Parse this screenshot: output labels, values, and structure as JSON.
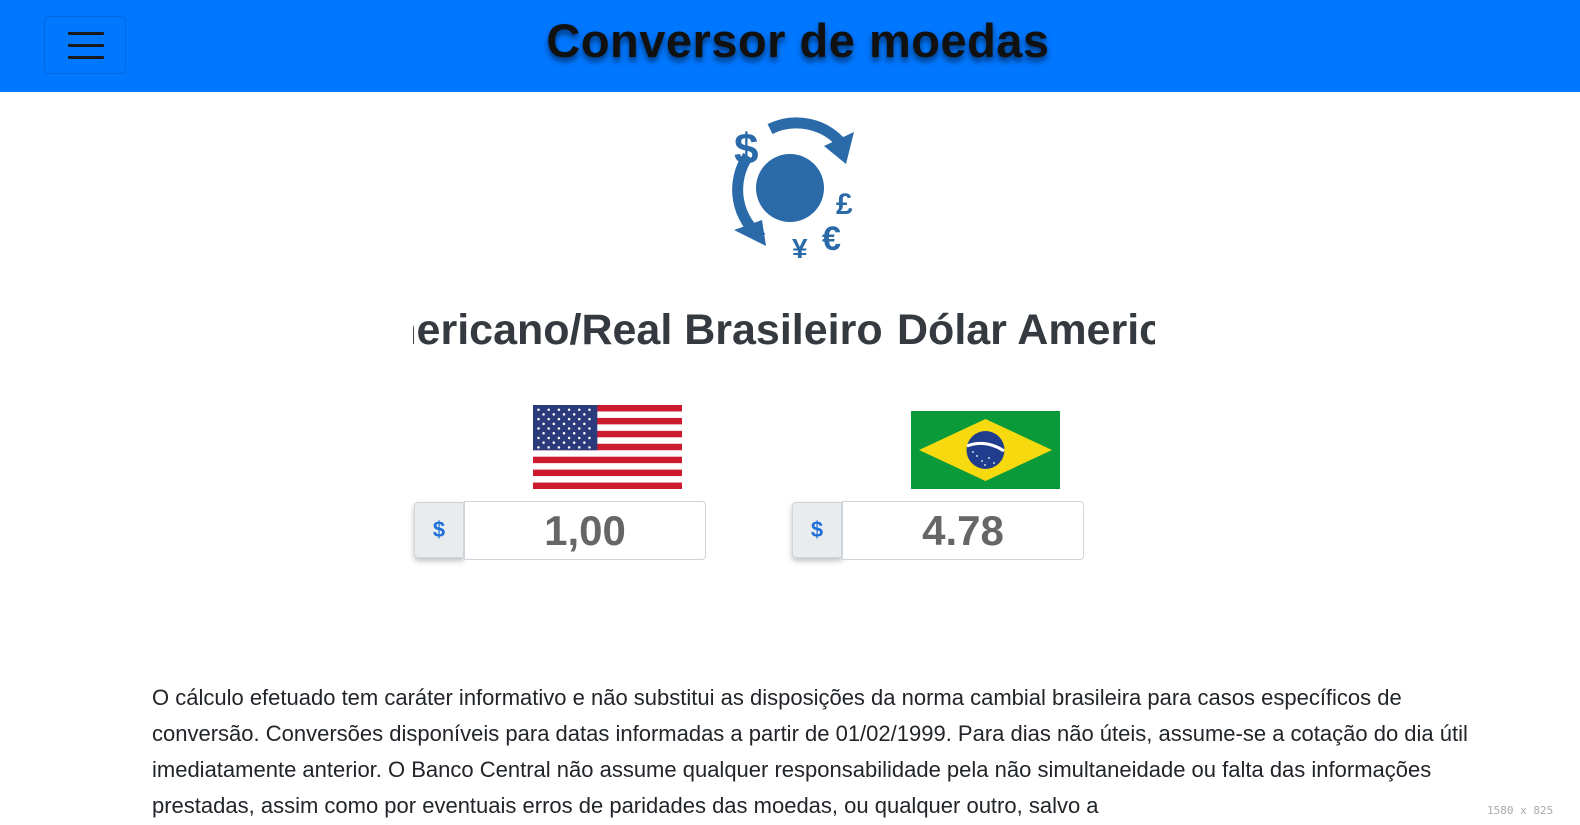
{
  "navbar": {
    "menu_icon": "hamburger-menu-icon",
    "title": "Conversor de moedas",
    "background_color": "#0077ff"
  },
  "logo": {
    "icon": "currency-exchange-icon",
    "symbols": [
      "$",
      "£",
      "€",
      "¥"
    ],
    "color": "#2a6aa8"
  },
  "marquee": {
    "text_left": "Dólar Americano/Real Brasileiro",
    "text_right": "Dólar Americano/Real Brasileiro"
  },
  "converter": {
    "from": {
      "flag_icon": "us-flag-icon",
      "symbol": "$",
      "value": "1,00"
    },
    "to": {
      "flag_icon": "brazil-flag-icon",
      "symbol": "$",
      "value": "4.78"
    }
  },
  "disclaimer": "O cálculo efetuado tem caráter informativo e não substitui as disposições da norma cambial brasileira para casos específicos de conversão. Conversões disponíveis para datas informadas a partir de 01/02/1999. Para dias não úteis, assume-se a cotação do dia útil imediatamente anterior. O Banco Central não assume qualquer responsabilidade pela não simultaneidade ou falta das informações prestadas, assim como por eventuais erros de paridades das moedas, ou qualquer outro, salvo a",
  "overlay": {
    "dimensions_text": "1580 x 825"
  }
}
